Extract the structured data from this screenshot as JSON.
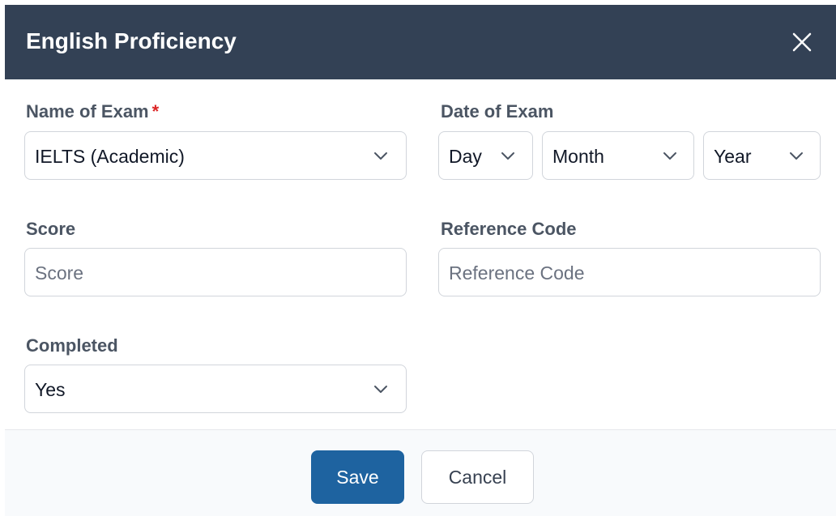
{
  "dialog": {
    "title": "English Proficiency",
    "close_icon": "close-icon"
  },
  "form": {
    "exam_name": {
      "label": "Name of Exam",
      "required_marker": "*",
      "value": "IELTS (Academic)"
    },
    "exam_date": {
      "label": "Date of Exam",
      "day": "Day",
      "month": "Month",
      "year": "Year"
    },
    "score": {
      "label": "Score",
      "placeholder": "Score"
    },
    "reference_code": {
      "label": "Reference Code",
      "placeholder": "Reference Code"
    },
    "completed": {
      "label": "Completed",
      "value": "Yes"
    }
  },
  "footer": {
    "save_label": "Save",
    "cancel_label": "Cancel"
  },
  "colors": {
    "header_bg": "#334155",
    "primary_button": "#1e63a0",
    "required": "#dc2626"
  }
}
